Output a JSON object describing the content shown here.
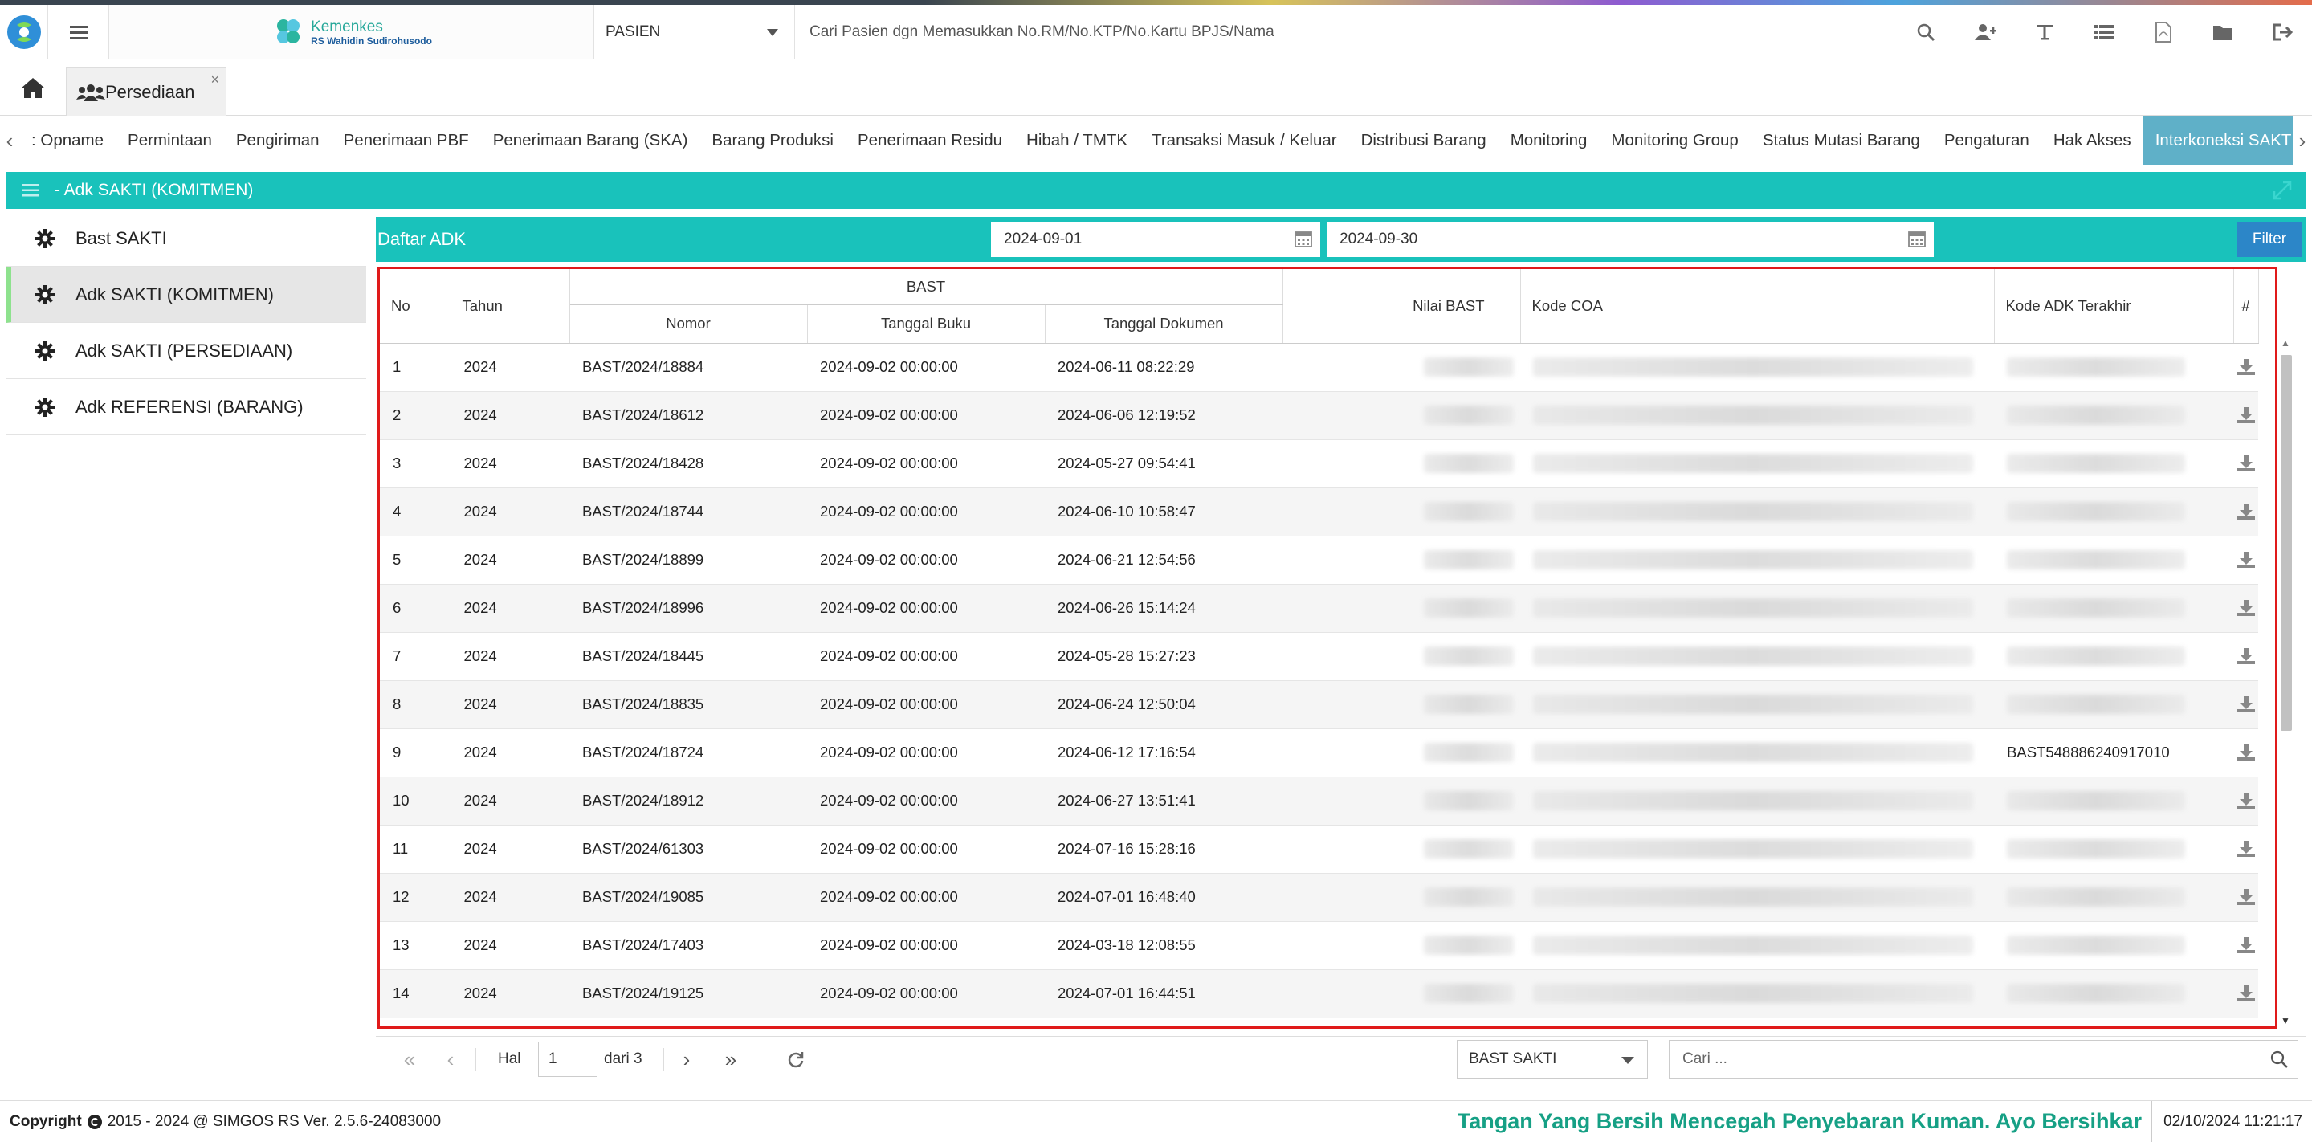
{
  "header": {
    "brand_line1": "Kemenkes",
    "brand_line2": "RS Wahidin Sudirohusodo",
    "search_type": "PASIEN",
    "search_placeholder": "Cari Pasien dgn Memasukkan No.RM/No.KTP/No.Kartu BPJS/Nama",
    "icons": [
      "search-icon",
      "add-user-icon",
      "text-icon",
      "list-icon",
      "pdf-icon",
      "folder-icon",
      "logout-icon"
    ]
  },
  "tabs": {
    "page_tab_label": "Persediaan",
    "close": "×"
  },
  "menubar": {
    "items": [
      ": Opname",
      "Permintaan",
      "Pengiriman",
      "Penerimaan PBF",
      "Penerimaan Barang (SKA)",
      "Barang Produksi",
      "Penerimaan Residu",
      "Hibah / TMTK",
      "Transaksi Masuk / Keluar",
      "Distribusi Barang",
      "Monitoring",
      "Monitoring Group",
      "Status Mutasi Barang",
      "Pengaturan",
      "Hak Akses",
      "Interkoneksi SAKTI"
    ],
    "active_index": 15
  },
  "panel": {
    "title": "- Adk SAKTI (KOMITMEN)"
  },
  "sidebar": {
    "items": [
      {
        "label": "Bast SAKTI"
      },
      {
        "label": "Adk SAKTI (KOMITMEN)"
      },
      {
        "label": "Adk SAKTI (PERSEDIAAN)"
      },
      {
        "label": "Adk REFERENSI (BARANG)"
      }
    ],
    "active_index": 1
  },
  "daftar": {
    "title": "Daftar ADK",
    "date_from": "2024-09-01",
    "date_to": "2024-09-30",
    "filter_label": "Filter"
  },
  "table": {
    "headers": {
      "no": "No",
      "tahun": "Tahun",
      "bast": "BAST",
      "nomor": "Nomor",
      "tgl_buku": "Tanggal Buku",
      "tgl_dok": "Tanggal Dokumen",
      "nilai": "Nilai BAST",
      "coa": "Kode COA",
      "adk": "Kode ADK Terakhir",
      "hash": "#"
    },
    "rows": [
      {
        "no": "1",
        "tahun": "2024",
        "nomor": "BAST/2024/18884",
        "tgl_buku": "2024-09-02 00:00:00",
        "tgl_dok": "2024-06-11 08:22:29",
        "adk": ""
      },
      {
        "no": "2",
        "tahun": "2024",
        "nomor": "BAST/2024/18612",
        "tgl_buku": "2024-09-02 00:00:00",
        "tgl_dok": "2024-06-06 12:19:52",
        "adk": ""
      },
      {
        "no": "3",
        "tahun": "2024",
        "nomor": "BAST/2024/18428",
        "tgl_buku": "2024-09-02 00:00:00",
        "tgl_dok": "2024-05-27 09:54:41",
        "adk": ""
      },
      {
        "no": "4",
        "tahun": "2024",
        "nomor": "BAST/2024/18744",
        "tgl_buku": "2024-09-02 00:00:00",
        "tgl_dok": "2024-06-10 10:58:47",
        "adk": ""
      },
      {
        "no": "5",
        "tahun": "2024",
        "nomor": "BAST/2024/18899",
        "tgl_buku": "2024-09-02 00:00:00",
        "tgl_dok": "2024-06-21 12:54:56",
        "adk": ""
      },
      {
        "no": "6",
        "tahun": "2024",
        "nomor": "BAST/2024/18996",
        "tgl_buku": "2024-09-02 00:00:00",
        "tgl_dok": "2024-06-26 15:14:24",
        "adk": ""
      },
      {
        "no": "7",
        "tahun": "2024",
        "nomor": "BAST/2024/18445",
        "tgl_buku": "2024-09-02 00:00:00",
        "tgl_dok": "2024-05-28 15:27:23",
        "adk": ""
      },
      {
        "no": "8",
        "tahun": "2024",
        "nomor": "BAST/2024/18835",
        "tgl_buku": "2024-09-02 00:00:00",
        "tgl_dok": "2024-06-24 12:50:04",
        "adk": ""
      },
      {
        "no": "9",
        "tahun": "2024",
        "nomor": "BAST/2024/18724",
        "tgl_buku": "2024-09-02 00:00:00",
        "tgl_dok": "2024-06-12 17:16:54",
        "adk": "BAST548886240917010"
      },
      {
        "no": "10",
        "tahun": "2024",
        "nomor": "BAST/2024/18912",
        "tgl_buku": "2024-09-02 00:00:00",
        "tgl_dok": "2024-06-27 13:51:41",
        "adk": ""
      },
      {
        "no": "11",
        "tahun": "2024",
        "nomor": "BAST/2024/61303",
        "tgl_buku": "2024-09-02 00:00:00",
        "tgl_dok": "2024-07-16 15:28:16",
        "adk": ""
      },
      {
        "no": "12",
        "tahun": "2024",
        "nomor": "BAST/2024/19085",
        "tgl_buku": "2024-09-02 00:00:00",
        "tgl_dok": "2024-07-01 16:48:40",
        "adk": ""
      },
      {
        "no": "13",
        "tahun": "2024",
        "nomor": "BAST/2024/17403",
        "tgl_buku": "2024-09-02 00:00:00",
        "tgl_dok": "2024-03-18 12:08:55",
        "adk": ""
      },
      {
        "no": "14",
        "tahun": "2024",
        "nomor": "BAST/2024/19125",
        "tgl_buku": "2024-09-02 00:00:00",
        "tgl_dok": "2024-07-01 16:44:51",
        "adk": ""
      }
    ]
  },
  "pager": {
    "hal_label": "Hal",
    "page": "1",
    "of_label": "dari 3",
    "type_select": "BAST SAKTI",
    "search_placeholder": "Cari ..."
  },
  "footer": {
    "copyright_prefix": "Copyright",
    "copyright_rest": "2015 - 2024 @ SIMGOS RS Ver. 2.5.6-24083000",
    "slogan": "Tangan Yang Bersih Mencegah Penyebaran Kuman. Ayo Bersihkar",
    "datetime": "02/10/2024 11:21:17"
  },
  "colors": {
    "teal": "#19c2bb",
    "active_tab": "#5fb0c8",
    "filter_button": "#2c86c8",
    "highlight_border": "#e01a1a",
    "slogan": "#16a085"
  }
}
